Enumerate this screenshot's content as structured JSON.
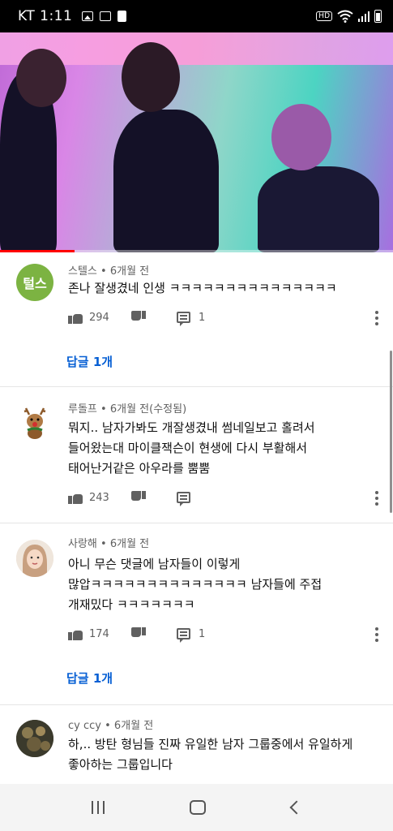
{
  "status_bar": {
    "carrier": "KT",
    "time": "1:11",
    "hd_label": "HD"
  },
  "video": {
    "progress_fraction": 0.19
  },
  "comments": [
    {
      "author": "스텔스",
      "age": "6개월 전",
      "avatar_text": "털스",
      "avatar_color": "#7cb342",
      "text": "존나 잘생겼네 인생 ㅋㅋㅋㅋㅋㅋㅋㅋㅋㅋㅋㅋㅋㅋㅋ",
      "likes": "294",
      "reply_count": "1",
      "replies_link": "답글 1개"
    },
    {
      "author": "루돌프",
      "age": "6개월 전(수정됨)",
      "avatar_text": "",
      "avatar_color": "#ffffff",
      "text": "뭐지.. 남자가봐도 개잘생겼내 썸네일보고 홀려서\n들어왔는대 마이클잭슨이 현생에 다시 부활해서\n태어난거같은 아우라를 뿜뿜",
      "likes": "243",
      "reply_count": "",
      "replies_link": ""
    },
    {
      "author": "사랑해",
      "age": "6개월 전",
      "avatar_text": "",
      "avatar_color": "#d8c0b0",
      "text": "아니 무슨 댓글에 남자들이 이렇게\n많압ㅋㅋㅋㅋㅋㅋㅋㅋㅋㅋㅋㅋㅋㅋ 남자들에 주접\n개재밌다 ㅋㅋㅋㅋㅋㅋㅋ",
      "likes": "174",
      "reply_count": "1",
      "replies_link": "답글 1개"
    },
    {
      "author": "cy ccy",
      "age": "6개월 전",
      "avatar_text": "",
      "avatar_color": "#4a4a3a",
      "text": "하,.. 방탄 형님들 진짜 유일한 남자 그룹중에서 유일하게\n좋아하는 그룹입니다",
      "likes": "",
      "reply_count": "",
      "replies_link": ""
    }
  ],
  "separator": "•"
}
